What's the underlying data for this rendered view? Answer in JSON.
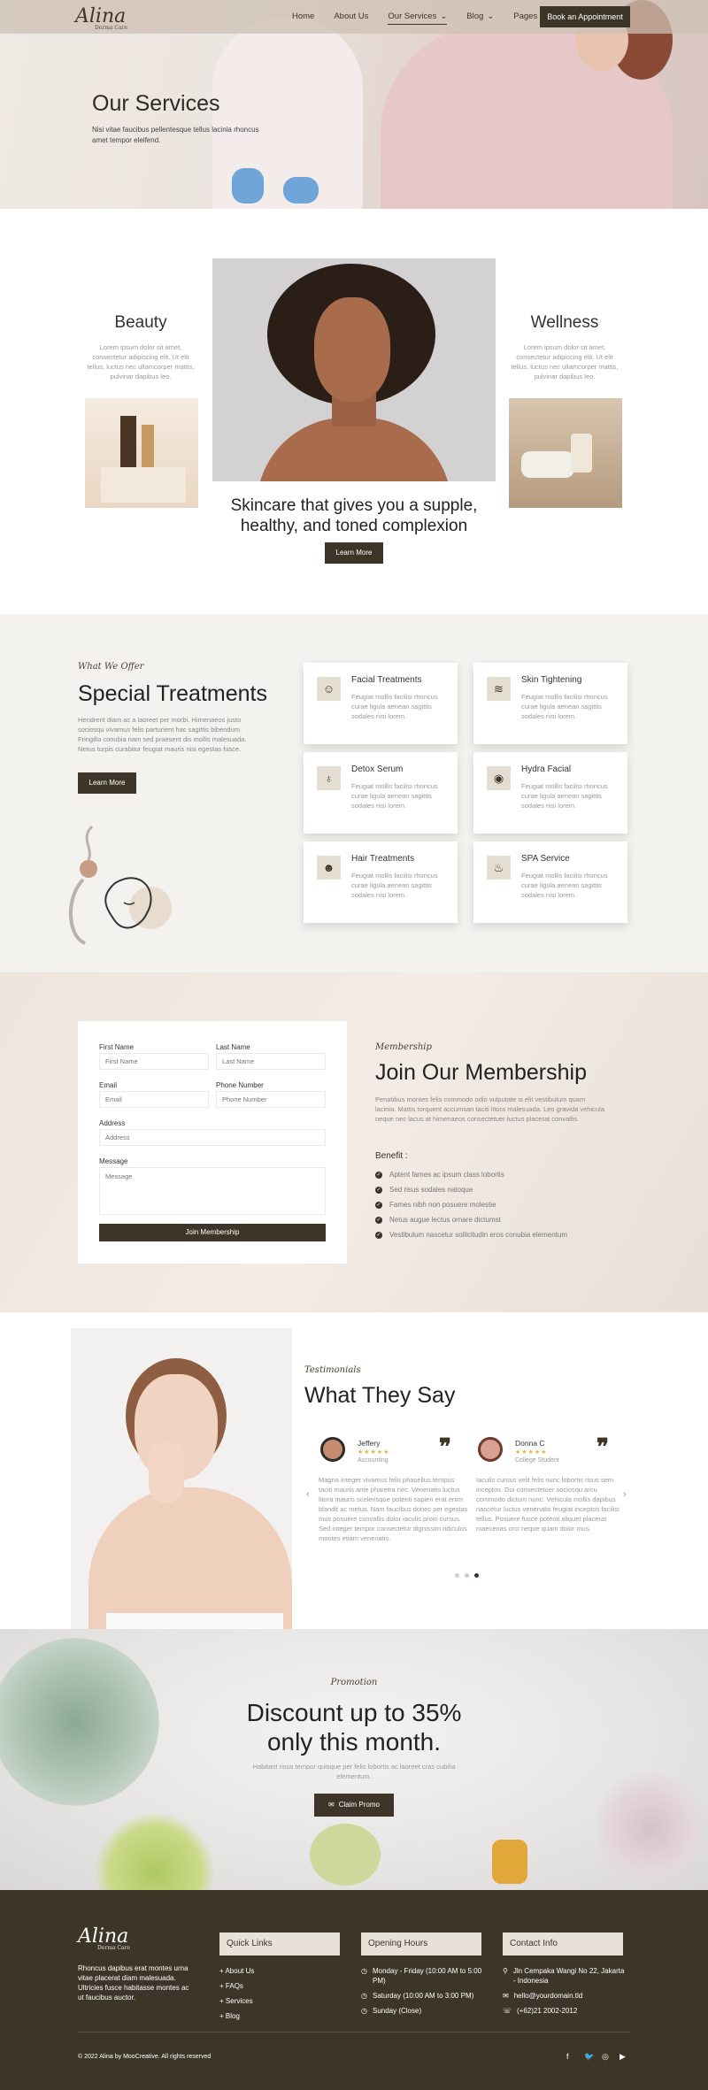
{
  "header": {
    "logo": "Alina",
    "logo_sub": "Derma Care",
    "menu": [
      "Home",
      "About Us",
      "Our Services",
      "Blog",
      "Pages"
    ],
    "book_button": "Book an Appointment"
  },
  "hero": {
    "title": "Our Services",
    "text": "Nisi vitae faucibus pellentesque tellus lacinia rhoncus amet tempor eleifend."
  },
  "services": {
    "beauty_title": "Beauty",
    "beauty_text": "Lorem ipsum dolor sit amet, consectetur adipiscing elit. Ut elit tellus, luctus nec ullamcorper mattis, pulvinar dapibus leo.",
    "wellness_title": "Wellness",
    "wellness_text": "Lorem ipsum dolor sit amet, consectetur adipiscing elit. Ut elit tellus, luctus nec ullamcorper mattis, pulvinar dapibus leo.",
    "tagline": "Skincare that gives you a supple, healthy, and toned complexion",
    "learn_more": "Learn More"
  },
  "treatments": {
    "eyebrow": "What We Offer",
    "title": "Special Treatments",
    "text": "Hendrerit diam ac a laoreet per morbi. Himenaeos justo sociosqu vivamus felis parturient hac sagittis bibendum. Fringilla conubia nam sed praesent dis mollis malesuada. Netus turpis curabitur feugiat mauris nisi egestas fusce.",
    "button": "Learn More",
    "cards": [
      {
        "title": "Facial Treatments",
        "text": "Feugiat mollis facilisi rhoncus curae ligula aenean sagittis sodales nisi lorem."
      },
      {
        "title": "Skin Tightening",
        "text": "Feugiat mollis facilisi rhoncus curae ligula aenean sagittis sodales nisi lorem."
      },
      {
        "title": "Detox Serum",
        "text": "Feugiat mollis facilisi rhoncus curae ligula aenean sagittis sodales nisi lorem."
      },
      {
        "title": "Hydra Facial",
        "text": "Feugiat mollis facilisi rhoncus curae ligula aenean sagittis sodales nisi lorem."
      },
      {
        "title": "Hair Treatments",
        "text": "Feugiat mollis facilisi rhoncus curae ligula aenean sagittis sodales nisi lorem."
      },
      {
        "title": "SPA Service",
        "text": "Feugiat mollis facilisi rhoncus curae ligula aenean sagittis sodales nisi lorem."
      }
    ]
  },
  "membership": {
    "form": {
      "first_name_label": "First Name",
      "first_name_placeholder": "First Name",
      "last_name_label": "Last Name",
      "last_name_placeholder": "Last Name",
      "email_label": "Email",
      "email_placeholder": "Email",
      "phone_label": "Phone Number",
      "phone_placeholder": "Phone Number",
      "address_label": "Address",
      "address_placeholder": "Address",
      "message_label": "Message",
      "message_placeholder": "Message",
      "submit": "Join Membership"
    },
    "eyebrow": "Membership",
    "title": "Join Our Membership",
    "text": "Penatibus montes felis commodo odio vulputate si elit vestibulum quam lacinia. Mattis torquent accumsan taciti litora malesuada. Leo gravida vehicula neque nec lacus at himenaeos consectetuer luctus placerat convallis.",
    "benefit_title": "Benefit :",
    "benefits": [
      "Aptent fames ac ipsum class lobortis",
      "Sed risus sodales natoque",
      "Fames nibh non posuere molestie",
      "Netus augue lectus ornare dictumst",
      "Vestibulum nascetur sollicitudin eros conubia elementum"
    ]
  },
  "testimonials": {
    "eyebrow": "Testimonials",
    "title": "What They Say",
    "items": [
      {
        "name": "Jeffery",
        "stars": "★★★★★",
        "role": "Accounting",
        "text": "Magna integer vivamus felis phasellus tempus taciti mauris ante pharetra nec. Venenatis luctus litora mauris scelerisque potenti sapien erat enim blandit ac metus. Nam faucibus donec per egestas mus posuere convallis dolor iaculis proin cursus. Sed integer tempor consectetur dignissim ridiculus montes etiam venenatis."
      },
      {
        "name": "Donna C",
        "stars": "★★★★★",
        "role": "College Student",
        "text": "Iaculis cursus velit felis nunc lobortis risus sem inceptos. Dui consectetuer sociosqu arcu commodo dictum nunc. Vehicula mollis dapibus nascetur luctus venenatis feugiat inceptos facilisi tellus. Posuere fusce potenti aliquet placerat maecenas orci neque quam dolor mus."
      }
    ]
  },
  "promo": {
    "eyebrow": "Promotion",
    "title": "Discount up to 35% only this month.",
    "text": "Habitant risus tempor quisque per felis lobortis ac laoreet cras cubilia elementum.",
    "button": "Claim Promo"
  },
  "footer": {
    "logo": "Alina",
    "logo_sub": "Derma Care",
    "about": "Rhoncus dapibus erat montes urna vitae placerat diam malesuada. Ultricies fusce habitasse montes ac ut faucibus auctor.",
    "quick_links_title": "Quick Links",
    "quick_links": [
      "About Us",
      "FAQs",
      "Services",
      "Blog"
    ],
    "hours_title": "Opening Hours",
    "hours": [
      "Monday - Friday (10:00 AM to 5:00 PM)",
      "Saturday (10:00 AM to 3:00 PM)",
      "Sunday (Close)"
    ],
    "contact_title": "Contact Info",
    "contact": [
      "Jln Cempaka Wangi No 22, Jakarta - Indonesia",
      "hello@yourdomain.tld",
      "(+62)21 2002-2012"
    ],
    "copyright": "© 2022 Alina by MooCreative. All rights reserved",
    "social_icons": [
      "facebook-icon",
      "twitter-icon",
      "instagram-icon",
      "youtube-icon"
    ]
  },
  "colors": {
    "accent": "#3e3529",
    "beige": "#e7e1d8",
    "light_bg": "#f3f2ee"
  }
}
